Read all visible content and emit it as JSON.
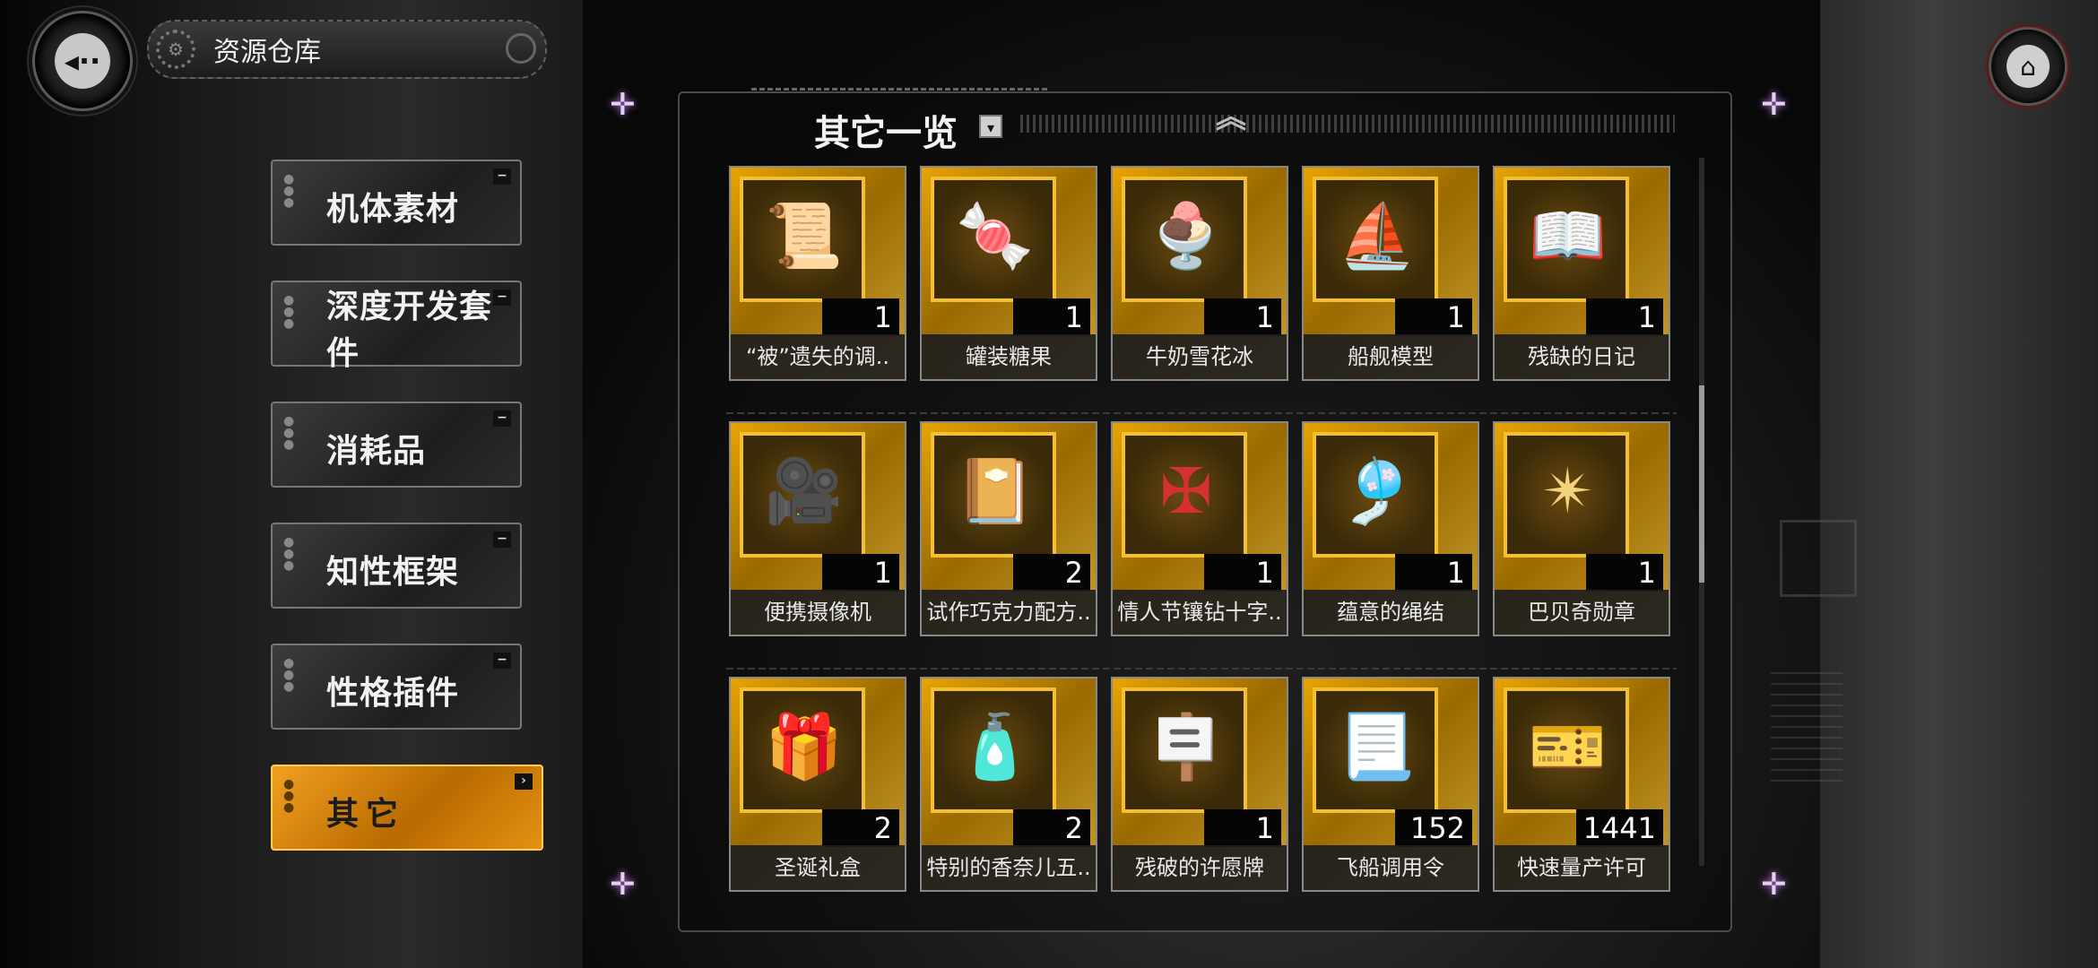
{
  "header": {
    "title": "资源仓库"
  },
  "icons": {
    "back": "back-arrow-icon",
    "home": "home-icon",
    "gear": "gear-icon"
  },
  "categories": [
    {
      "label": "机体素材",
      "active": false
    },
    {
      "label": "深度开发套件",
      "active": false
    },
    {
      "label": "消耗品",
      "active": false
    },
    {
      "label": "知性框架",
      "active": false
    },
    {
      "label": "性格插件",
      "active": false
    },
    {
      "label": "其它",
      "active": true
    }
  ],
  "section": {
    "title": "其它一览"
  },
  "items": [
    {
      "name": "“被”遗失的调..",
      "qty": "1",
      "icon": "📜"
    },
    {
      "name": "罐装糖果",
      "qty": "1",
      "icon": "🍬"
    },
    {
      "name": "牛奶雪花冰",
      "qty": "1",
      "icon": "🍨"
    },
    {
      "name": "船舰模型",
      "qty": "1",
      "icon": "⛵"
    },
    {
      "name": "残缺的日记",
      "qty": "1",
      "icon": "📖"
    },
    {
      "name": "便携摄像机",
      "qty": "1",
      "icon": "🎥"
    },
    {
      "name": "试作巧克力配方..",
      "qty": "2",
      "icon": "📔"
    },
    {
      "name": "情人节镶钻十字..",
      "qty": "1",
      "icon": "✠"
    },
    {
      "name": "蕴意的绳结",
      "qty": "1",
      "icon": "🎐"
    },
    {
      "name": "巴贝奇勋章",
      "qty": "1",
      "icon": "✴"
    },
    {
      "name": "圣诞礼盒",
      "qty": "2",
      "icon": "🎁"
    },
    {
      "name": "特别的香奈儿五..",
      "qty": "2",
      "icon": "🧴"
    },
    {
      "name": "残破的许愿牌",
      "qty": "1",
      "icon": "🪧"
    },
    {
      "name": "飞船调用令",
      "qty": "152",
      "icon": "📃"
    },
    {
      "name": "快速量产许可",
      "qty": "1441",
      "icon": "🎫"
    }
  ],
  "colors": {
    "accent": "#f0a020",
    "card_gold": "#e8a400"
  }
}
